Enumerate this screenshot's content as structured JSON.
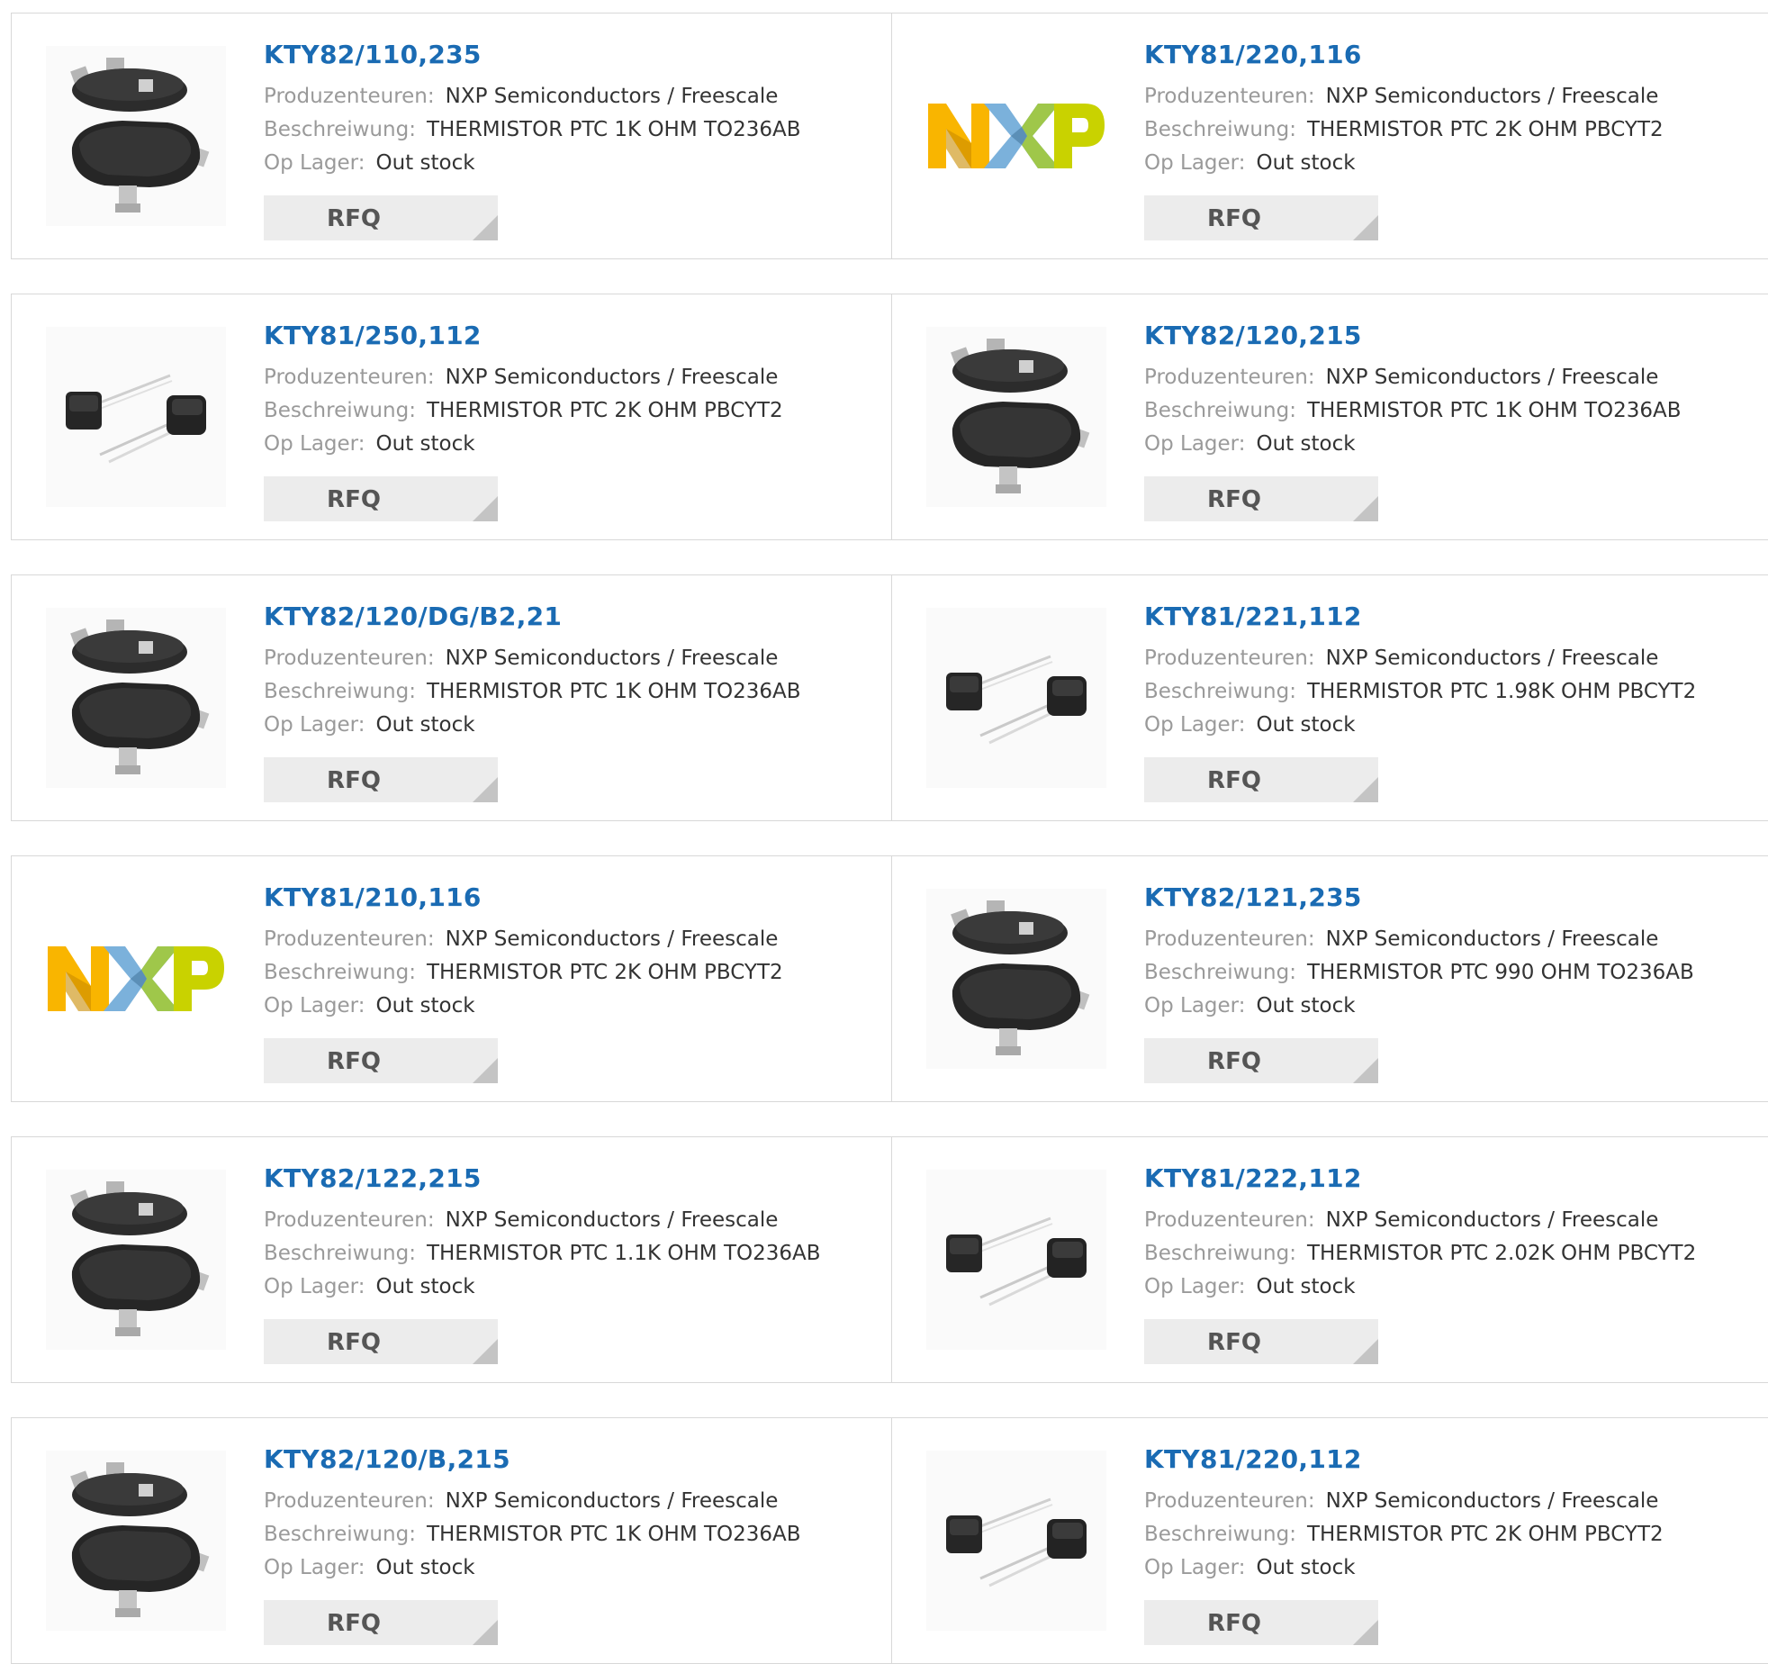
{
  "labels": {
    "manufacturer": "Produzenteuren:",
    "description": "Beschreiwung:",
    "stock": "Op Lager:",
    "rfq": "RFQ"
  },
  "colors": {
    "link": "#1a6bb3",
    "label": "#9a9a9a",
    "value": "#333333",
    "rfq_bg": "#ececec",
    "rfq_corner": "#c4c4c4",
    "nxp_n": "#f9b500",
    "nxp_x_left": "#7bb1db",
    "nxp_x_right": "#9fc74a",
    "nxp_p": "#c9d200"
  },
  "products": [
    {
      "part": "KTY82/110,235",
      "manufacturer": "NXP Semiconductors / Freescale",
      "description": "THERMISTOR PTC 1K OHM TO236AB",
      "stock": "Out stock",
      "image": "sot23-package-icon"
    },
    {
      "part": "KTY81/220,116",
      "manufacturer": "NXP Semiconductors / Freescale",
      "description": "THERMISTOR PTC 2K OHM PBCYT2",
      "stock": "Out stock",
      "image": "nxp-logo"
    },
    {
      "part": "KTY81/250,112",
      "manufacturer": "NXP Semiconductors / Freescale",
      "description": "THERMISTOR PTC 2K OHM PBCYT2",
      "stock": "Out stock",
      "image": "to92-package-icon"
    },
    {
      "part": "KTY82/120,215",
      "manufacturer": "NXP Semiconductors / Freescale",
      "description": "THERMISTOR PTC 1K OHM TO236AB",
      "stock": "Out stock",
      "image": "sot23-package-icon"
    },
    {
      "part": "KTY82/120/DG/B2,21",
      "manufacturer": "NXP Semiconductors / Freescale",
      "description": "THERMISTOR PTC 1K OHM TO236AB",
      "stock": "Out stock",
      "image": "sot23-package-icon"
    },
    {
      "part": "KTY81/221,112",
      "manufacturer": "NXP Semiconductors / Freescale",
      "description": "THERMISTOR PTC 1.98K OHM PBCYT2",
      "stock": "Out stock",
      "image": "to92-package-icon"
    },
    {
      "part": "KTY81/210,116",
      "manufacturer": "NXP Semiconductors / Freescale",
      "description": "THERMISTOR PTC 2K OHM PBCYT2",
      "stock": "Out stock",
      "image": "nxp-logo"
    },
    {
      "part": "KTY82/121,235",
      "manufacturer": "NXP Semiconductors / Freescale",
      "description": "THERMISTOR PTC 990 OHM TO236AB",
      "stock": "Out stock",
      "image": "sot23-package-icon"
    },
    {
      "part": "KTY82/122,215",
      "manufacturer": "NXP Semiconductors / Freescale",
      "description": "THERMISTOR PTC 1.1K OHM TO236AB",
      "stock": "Out stock",
      "image": "sot23-package-icon"
    },
    {
      "part": "KTY81/222,112",
      "manufacturer": "NXP Semiconductors / Freescale",
      "description": "THERMISTOR PTC 2.02K OHM PBCYT2",
      "stock": "Out stock",
      "image": "to92-package-icon"
    },
    {
      "part": "KTY82/120/B,215",
      "manufacturer": "NXP Semiconductors / Freescale",
      "description": "THERMISTOR PTC 1K OHM TO236AB",
      "stock": "Out stock",
      "image": "sot23-package-icon"
    },
    {
      "part": "KTY81/220,112",
      "manufacturer": "NXP Semiconductors / Freescale",
      "description": "THERMISTOR PTC 2K OHM PBCYT2",
      "stock": "Out stock",
      "image": "to92-package-icon"
    }
  ]
}
